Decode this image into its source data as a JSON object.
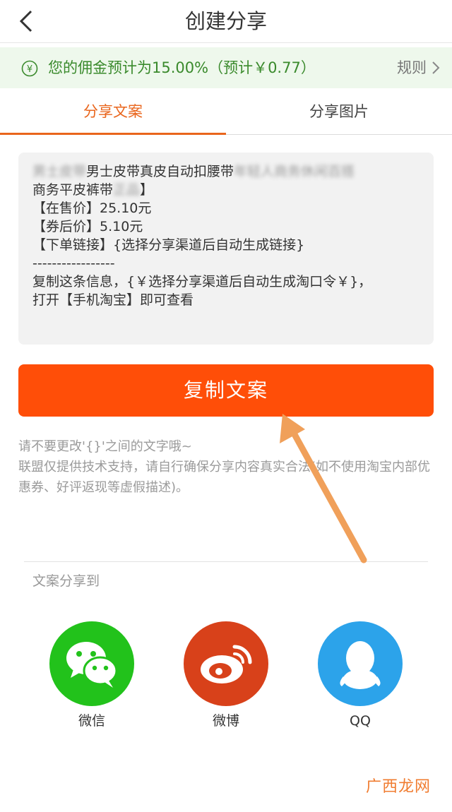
{
  "header": {
    "title": "创建分享"
  },
  "commission": {
    "text": "您的佣金预计为15.00%（预计￥0.77）",
    "rules_label": "规则"
  },
  "tabs": [
    {
      "label": "分享文案",
      "active": true
    },
    {
      "label": "分享图片",
      "active": false
    }
  ],
  "share_text": {
    "line1_blur_a": "男士皮带",
    "line1": "男士皮带真皮自动扣腰带",
    "line1_blur_b": "年轻人商务休闲百搭",
    "line2_prefix": "商务平皮裤带",
    "line2_blur": "正品",
    "line2_suffix": "】",
    "price": "【在售价】25.10元",
    "coupon_price": "【券后价】5.10元",
    "order_link": "【下单链接】{选择分享渠道后自动生成链接}",
    "separator": "-----------------",
    "copy_hint": "复制这条信息，{￥选择分享渠道后自动生成淘口令￥}，",
    "open_hint": "打开【手机淘宝】即可查看"
  },
  "copy_button": {
    "label": "复制文案"
  },
  "notes": {
    "line1": "请不要更改'{}'之间的文字哦~",
    "line2": "联盟仅提供技术支持，请自行确保分享内容真实合法(如不使用淘宝内部优惠券、好评返现等虚假描述)。"
  },
  "share_section": {
    "label": "文案分享到",
    "channels": [
      {
        "name": "微信",
        "icon": "wechat-icon",
        "color": "#22c21b"
      },
      {
        "name": "微博",
        "icon": "weibo-icon",
        "color": "#d8411a"
      },
      {
        "name": "QQ",
        "icon": "qq-icon",
        "color": "#2ca3ea"
      }
    ]
  },
  "watermark": {
    "text": "广西龙网"
  },
  "colors": {
    "accent": "#e9651c",
    "button": "#ff4e08",
    "commission_bg": "#eef8ec",
    "commission_text": "#3a8a2c",
    "arrow": "#f0a05a"
  }
}
